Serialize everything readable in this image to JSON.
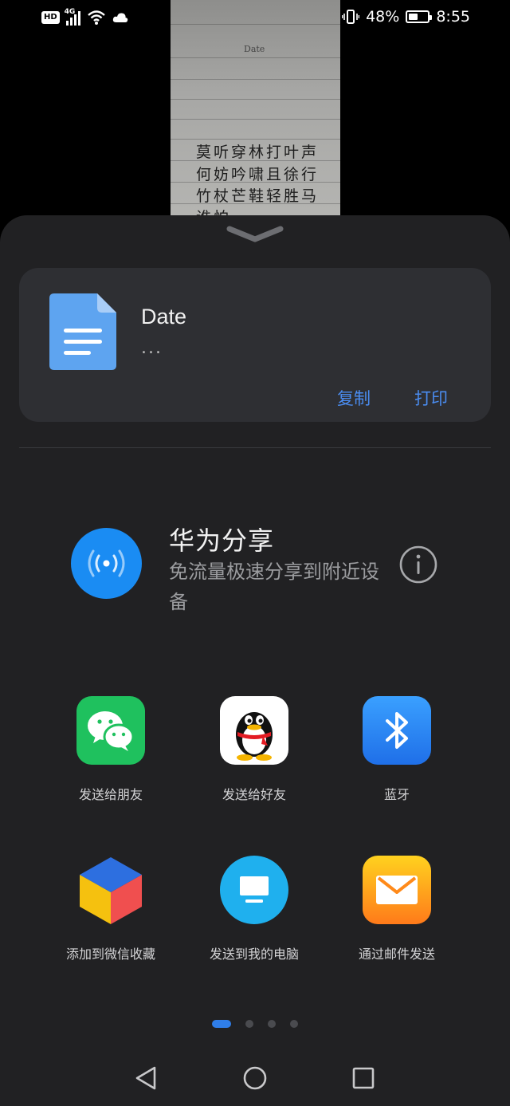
{
  "status_bar": {
    "hd_badge": "HD",
    "network": "4G",
    "battery_text": "48%",
    "battery_level": 0.48,
    "time": "8:55"
  },
  "preview": {
    "date_label": "Date",
    "handwriting": [
      "莫听穿林打叶声",
      "何妨吟啸且徐行",
      "竹杖芒鞋轻胜马",
      "谁怕"
    ]
  },
  "share_sheet": {
    "file": {
      "name": "Date",
      "size": "...",
      "icon": "document-icon",
      "copy_label": "复制",
      "print_label": "打印"
    },
    "huawei_share": {
      "title": "华为分享",
      "description": "免流量极速分享到附近设备",
      "icon": "huawei-share-icon"
    },
    "apps": [
      {
        "label": "发送给朋友",
        "icon": "wechat-icon"
      },
      {
        "label": "发送给好友",
        "icon": "qq-icon"
      },
      {
        "label": "蓝牙",
        "icon": "bluetooth-icon"
      },
      {
        "label": "添加到微信收藏",
        "icon": "wechat-favorites-icon"
      },
      {
        "label": "发送到我的电脑",
        "icon": "send-to-pc-icon"
      },
      {
        "label": "通过邮件发送",
        "icon": "email-icon"
      }
    ],
    "pagination": {
      "pages": 4,
      "current": 1
    }
  },
  "colors": {
    "sheet_bg": "#212123",
    "card_bg": "#2e2f33",
    "accent_blue": "#4a8cf0",
    "huawei_share_blue": "#1a8cf3",
    "wechat_green": "#1fc15e"
  }
}
